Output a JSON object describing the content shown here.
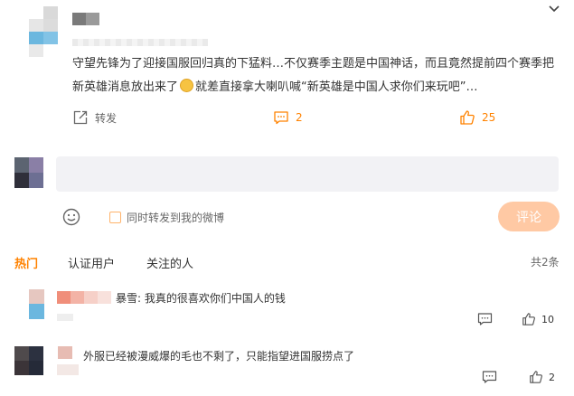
{
  "post": {
    "text": "守望先锋为了迎接国服回归真的下猛料…不仅赛季主题是中国神话，而且竟然提前四个赛季把新英雄消息放出来了",
    "text_after_emoji": "就差直接拿大喇叭喊“新英雄是中国人求你们来玩吧”…",
    "emoji_icon": "laughing-emoji-icon",
    "actions": {
      "repost_label": "转发",
      "comment_count": "2",
      "like_count": "25"
    }
  },
  "compose": {
    "placeholder": "",
    "also_repost_label": "同时转发到我的微博",
    "submit_label": "评论"
  },
  "tabs": {
    "hot": "热门",
    "verified": "认证用户",
    "following": "关注的人",
    "total": "共2条"
  },
  "comments": [
    {
      "text": "暴雪: 我真的很喜欢你们中国人的钱",
      "like_count": "10"
    },
    {
      "text": "外服已经被漫威爆的毛也不剩了，只能指望进国服捞点了",
      "like_count": "2"
    }
  ],
  "colors": {
    "accent": "#ff8200",
    "submit_disabled": "#ffc9a4",
    "input_bg": "#f2f2f5"
  },
  "icons": {
    "collapse": "chevron-down-icon",
    "repost": "repost-icon",
    "comment": "comment-icon",
    "like": "thumbs-up-icon",
    "emoji": "smiley-icon"
  }
}
